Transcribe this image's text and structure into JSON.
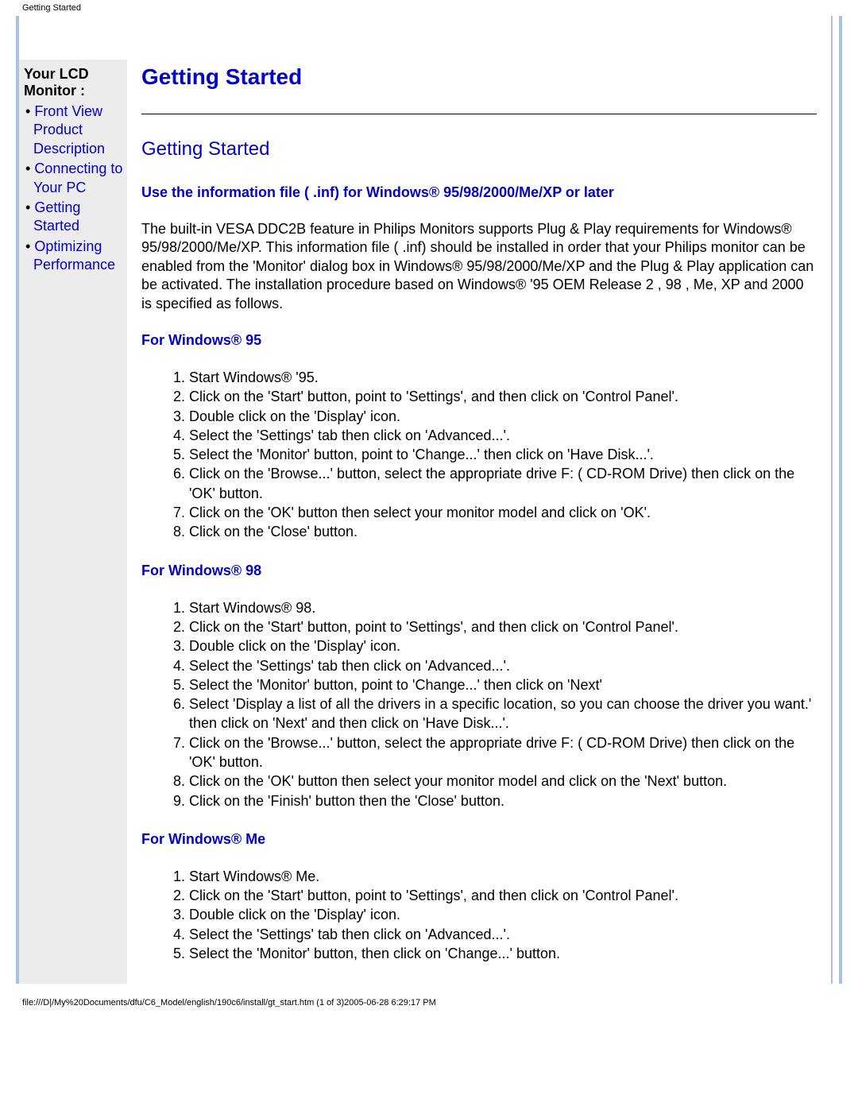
{
  "header": "Getting Started",
  "sidebar": {
    "title": "Your LCD Monitor :",
    "items": [
      {
        "label": "Front View Product Description"
      },
      {
        "label": "Connecting to Your PC"
      },
      {
        "label": "Getting Started"
      },
      {
        "label": "Optimizing Performance"
      }
    ]
  },
  "main": {
    "title": "Getting Started",
    "section_head": "Getting Started",
    "sub_head": "Use the information file ( .inf) for Windows® 95/98/2000/Me/XP or later",
    "intro": "The built-in VESA DDC2B feature in Philips Monitors supports Plug & Play requirements for Windows® 95/98/2000/Me/XP. This information file ( .inf) should be installed in order that your Philips monitor can be enabled from the 'Monitor' dialog box in Windows® 95/98/2000/Me/XP and the Plug & Play application can be activated. The installation procedure based on Windows® '95 OEM Release 2 , 98 , Me, XP and 2000 is specified as follows.",
    "sections": [
      {
        "head": "For Windows® 95",
        "steps": [
          "Start Windows® '95.",
          "Click on the 'Start' button, point to 'Settings', and then click on 'Control Panel'.",
          "Double click on the 'Display' icon.",
          "Select the 'Settings' tab then click on 'Advanced...'.",
          "Select the 'Monitor' button, point to 'Change...' then click on 'Have Disk...'.",
          "Click on the 'Browse...' button, select the appropriate drive F: ( CD-ROM Drive) then click on the 'OK' button.",
          "Click on the 'OK' button then select your monitor model and click on 'OK'.",
          "Click on the 'Close' button."
        ]
      },
      {
        "head": "For Windows® 98",
        "steps": [
          "Start Windows® 98.",
          "Click on the 'Start' button, point to 'Settings', and then click on 'Control Panel'.",
          "Double click on the 'Display' icon.",
          "Select the 'Settings' tab then click on 'Advanced...'.",
          "Select the 'Monitor' button, point to 'Change...' then click on 'Next'",
          "Select 'Display a list of all the drivers in a specific location, so you can choose the driver you want.' then click on 'Next' and then click on 'Have Disk...'.",
          "Click on the 'Browse...' button, select the appropriate drive F: ( CD-ROM Drive) then click on the 'OK' button.",
          "Click on the 'OK' button then select your monitor model and click on the 'Next' button.",
          "Click on the 'Finish' button then the 'Close' button."
        ]
      },
      {
        "head": "For Windows® Me",
        "steps": [
          "Start Windows® Me.",
          "Click on the 'Start' button, point to 'Settings', and then click on 'Control Panel'.",
          "Double click on the 'Display' icon.",
          "Select the 'Settings' tab then click on 'Advanced...'.",
          "Select the 'Monitor' button, then click on 'Change...' button."
        ]
      }
    ]
  },
  "footer": "file:///D|/My%20Documents/dfu/C6_Model/english/190c6/install/gt_start.htm (1 of 3)2005-06-28 6:29:17 PM"
}
